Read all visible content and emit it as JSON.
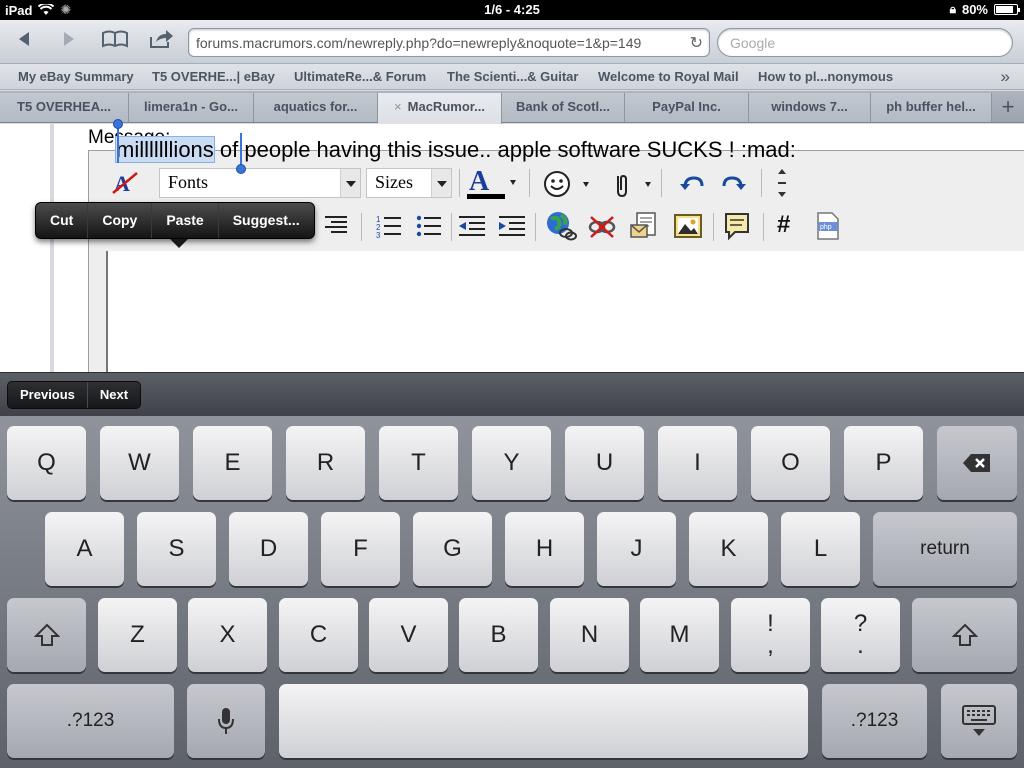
{
  "statusbar": {
    "device": "iPad",
    "time": "1/6 - 4:25",
    "battery": "80%"
  },
  "browser": {
    "url": "forums.macrumors.com/newreply.php?do=newreply&noquote=1&p=149",
    "search_placeholder": "Google",
    "bookmarks": [
      "My eBay Summary",
      "T5 OVERHE...| eBay",
      "UltimateRe...& Forum",
      "The Scienti...& Guitar",
      "Welcome to Royal Mail",
      "How to pl...nonymous"
    ],
    "bookmarks_more": "»",
    "tabs": [
      "T5 OVERHEA...",
      "limera1n - Go...",
      "aquatics for...",
      "MacRumor...",
      "Bank of Scotl...",
      "PayPal Inc.",
      "windows 7...",
      "ph buffer hel..."
    ],
    "tab_close": "×",
    "new_tab": "+"
  },
  "editor": {
    "label": "Message:",
    "font_select": "Fonts",
    "size_select": "Sizes",
    "selected_word": "milllllllions",
    "rest_text": " of people having this issue.. apple software SUCKS ! :mad:"
  },
  "context_menu": {
    "items": [
      "Cut",
      "Copy",
      "Paste",
      "Suggest..."
    ]
  },
  "accessory": {
    "previous": "Previous",
    "next": "Next"
  },
  "keyboard": {
    "row1": [
      "Q",
      "W",
      "E",
      "R",
      "T",
      "Y",
      "U",
      "I",
      "O",
      "P"
    ],
    "row2": [
      "A",
      "S",
      "D",
      "F",
      "G",
      "H",
      "J",
      "K",
      "L"
    ],
    "row3": [
      "Z",
      "X",
      "C",
      "V",
      "B",
      "N",
      "M"
    ],
    "punct1_top": "!",
    "punct1_bottom": ",",
    "punct2_top": "?",
    "punct2_bottom": ".",
    "return": "return",
    "numbers": ".?123"
  }
}
